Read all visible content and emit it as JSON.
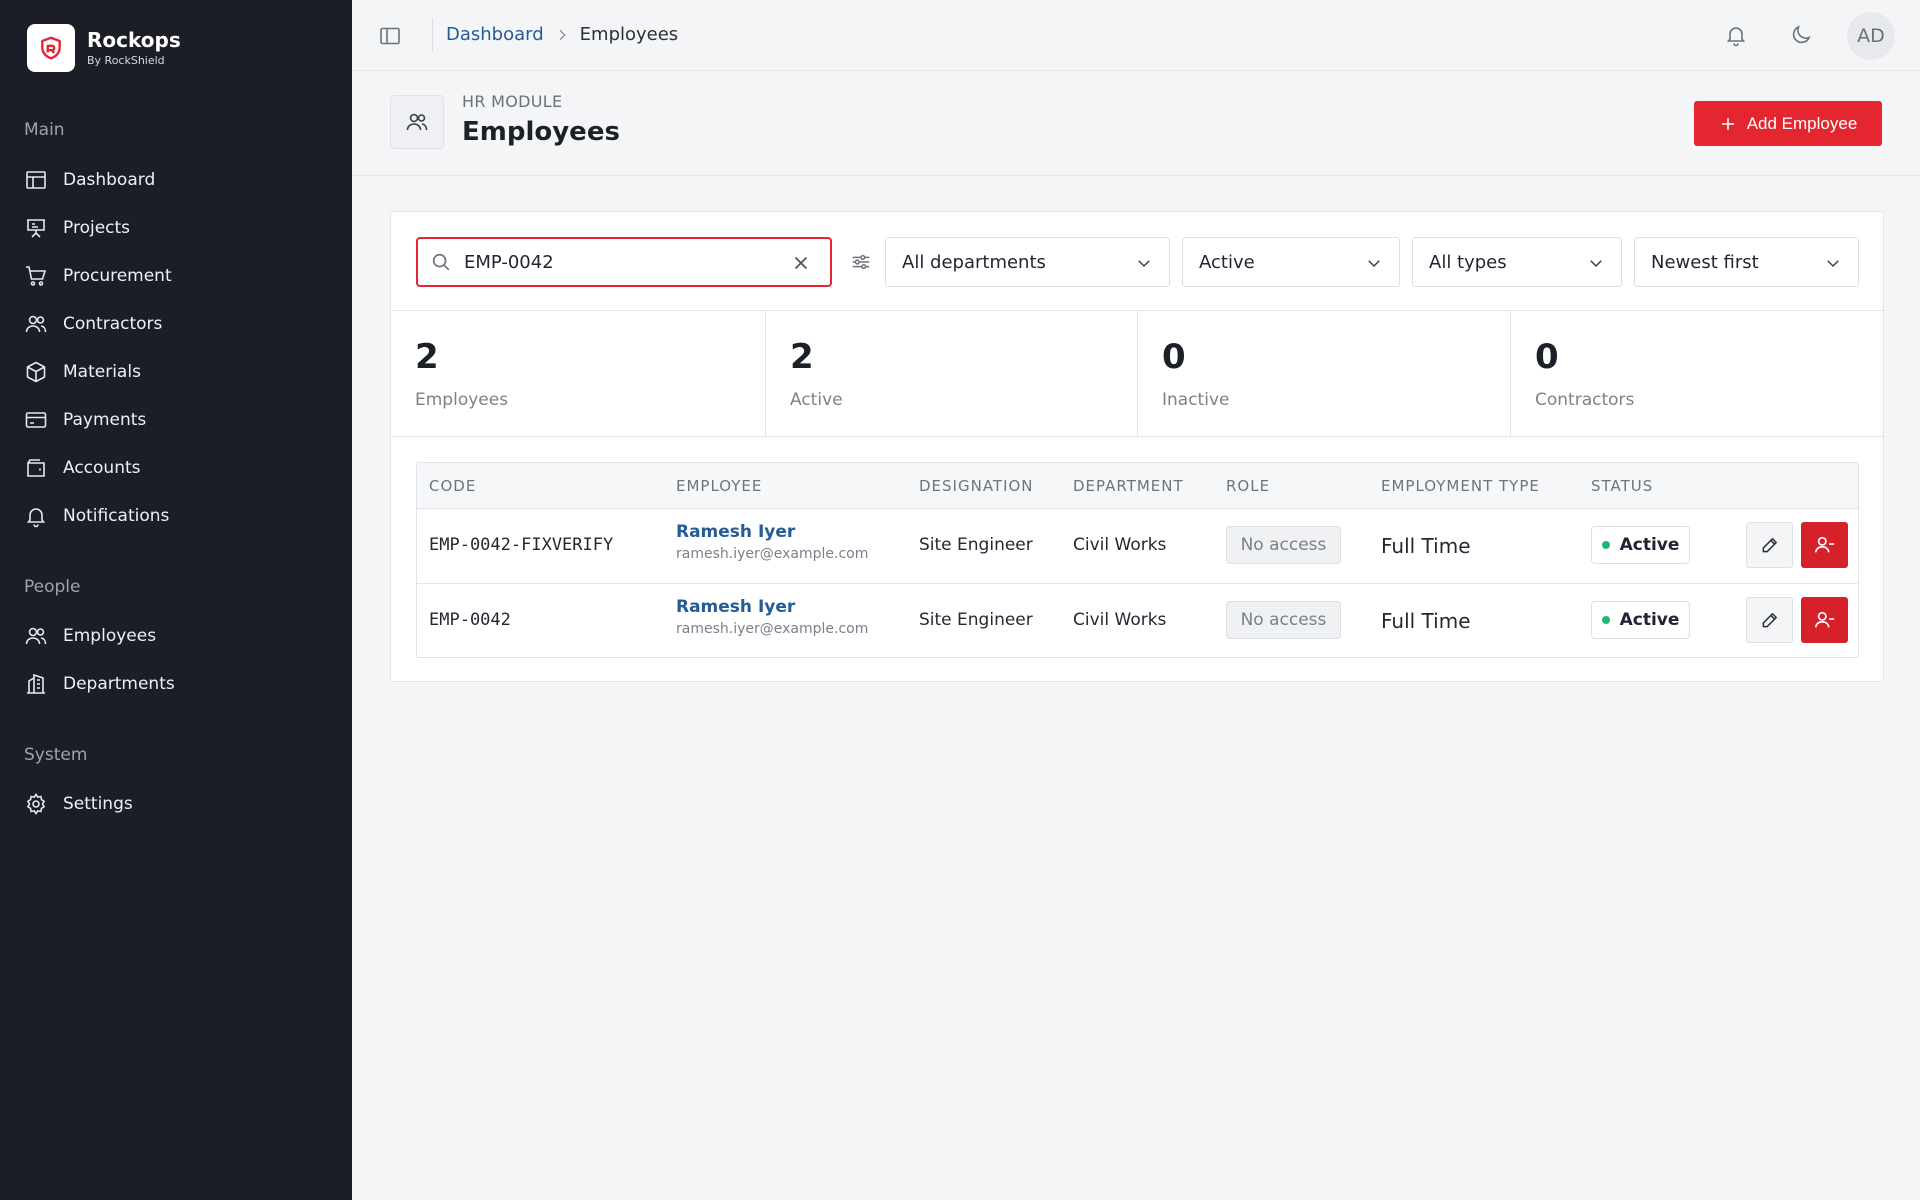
{
  "brand": {
    "name": "Rockops",
    "subtitle": "By RockShield",
    "logo_icon": "shield-logo-icon",
    "accent": "#e3262f"
  },
  "sidebar": {
    "sections": [
      {
        "label": "Main",
        "items": [
          {
            "label": "Dashboard",
            "icon": "dashboard-icon"
          },
          {
            "label": "Projects",
            "icon": "projects-icon"
          },
          {
            "label": "Procurement",
            "icon": "cart-icon"
          },
          {
            "label": "Contractors",
            "icon": "users-icon"
          },
          {
            "label": "Materials",
            "icon": "box-icon"
          },
          {
            "label": "Payments",
            "icon": "card-icon"
          },
          {
            "label": "Accounts",
            "icon": "wallet-icon"
          },
          {
            "label": "Notifications",
            "icon": "bell-icon"
          }
        ]
      },
      {
        "label": "People",
        "items": [
          {
            "label": "Employees",
            "icon": "users-icon"
          },
          {
            "label": "Departments",
            "icon": "building-icon"
          }
        ]
      },
      {
        "label": "System",
        "items": [
          {
            "label": "Settings",
            "icon": "gear-icon"
          }
        ]
      }
    ]
  },
  "topbar": {
    "breadcrumb": {
      "parent": "Dashboard",
      "current": "Employees"
    },
    "avatar_initials": "AD"
  },
  "page": {
    "kicker": "HR MODULE",
    "title": "Employees",
    "add_button_label": "Add Employee"
  },
  "filters": {
    "search_value": "EMP-0042",
    "department": "All departments",
    "status": "Active",
    "type": "All types",
    "sort": "Newest first"
  },
  "stats": [
    {
      "value": "2",
      "label": "Employees"
    },
    {
      "value": "2",
      "label": "Active"
    },
    {
      "value": "0",
      "label": "Inactive"
    },
    {
      "value": "0",
      "label": "Contractors"
    }
  ],
  "table": {
    "headers": [
      "CODE",
      "EMPLOYEE",
      "DESIGNATION",
      "DEPARTMENT",
      "ROLE",
      "EMPLOYMENT TYPE",
      "STATUS"
    ],
    "rows": [
      {
        "code": "EMP-0042-FIXVERIFY",
        "name": "Ramesh Iyer",
        "email": "ramesh.iyer@example.com",
        "designation": "Site Engineer",
        "department": "Civil Works",
        "role": "No access",
        "type": "Full Time",
        "status": "Active"
      },
      {
        "code": "EMP-0042",
        "name": "Ramesh Iyer",
        "email": "ramesh.iyer@example.com",
        "designation": "Site Engineer",
        "department": "Civil Works",
        "role": "No access",
        "type": "Full Time",
        "status": "Active"
      }
    ]
  },
  "colors": {
    "sidebar_bg": "#1b1e26",
    "link": "#255b96",
    "status_active": "#22b573",
    "danger": "#d6212b"
  }
}
